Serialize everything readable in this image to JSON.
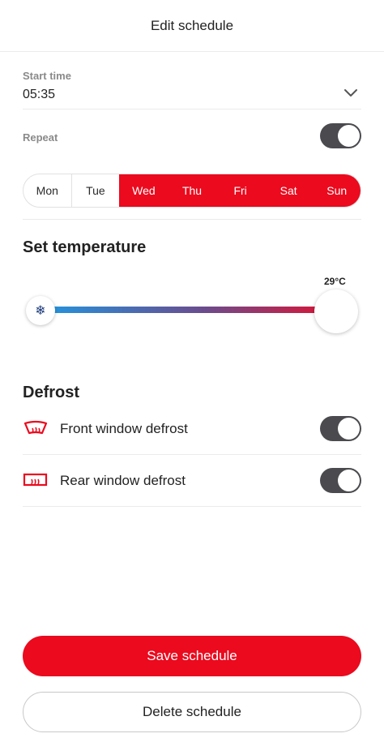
{
  "header": {
    "title": "Edit schedule"
  },
  "start_time": {
    "label": "Start time",
    "value": "05:35",
    "dropdown_icon": "chevron-down-icon"
  },
  "repeat": {
    "label": "Repeat",
    "enabled": true
  },
  "days": [
    {
      "label": "Mon",
      "selected": false
    },
    {
      "label": "Tue",
      "selected": false
    },
    {
      "label": "Wed",
      "selected": true
    },
    {
      "label": "Thu",
      "selected": true
    },
    {
      "label": "Fri",
      "selected": true
    },
    {
      "label": "Sat",
      "selected": true
    },
    {
      "label": "Sun",
      "selected": true
    }
  ],
  "temperature": {
    "title": "Set temperature",
    "value_label": "29°C",
    "min_icon": "snowflake-icon",
    "gradient_colors": [
      "#2196e0",
      "#6a4c8e",
      "#e01230"
    ]
  },
  "defrost": {
    "title": "Defrost",
    "items": [
      {
        "label": "Front window defrost",
        "icon": "front-defrost-icon",
        "enabled": true
      },
      {
        "label": "Rear window defrost",
        "icon": "rear-defrost-icon",
        "enabled": true
      }
    ]
  },
  "actions": {
    "save_label": "Save schedule",
    "delete_label": "Delete schedule"
  },
  "colors": {
    "accent": "#eb0a1e",
    "toggle_on": "#4a4a4f",
    "divider": "#ebebeb"
  }
}
